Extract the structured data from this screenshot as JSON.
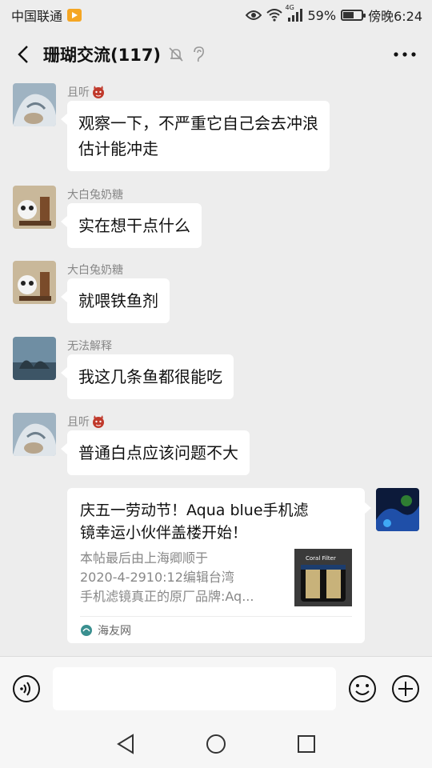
{
  "status_bar": {
    "carrier": "中国联通",
    "network": "4G",
    "battery": "59%",
    "battery_level": 0.59,
    "time": "傍晚6:24"
  },
  "nav": {
    "title": "珊瑚交流(117)"
  },
  "messages": [
    {
      "sender": "且听",
      "text_lines": [
        "观察一下，不严重它自己会去冲浪",
        "估计能冲走"
      ]
    },
    {
      "sender": "大白兔奶糖",
      "text_lines": [
        "实在想干点什么"
      ]
    },
    {
      "sender": "大白兔奶糖",
      "text_lines": [
        "就喂铁鱼剂"
      ]
    },
    {
      "sender": "无法解释",
      "text_lines": [
        "我这几条鱼都很能吃"
      ]
    },
    {
      "sender": "且听",
      "text_lines": [
        "普通白点应该问题不大"
      ]
    }
  ],
  "link_card": {
    "title_lines": [
      "庆五一劳动节！Aqua blue手机滤",
      "镜幸运小伙伴盖楼开始！"
    ],
    "desc_lines": [
      "本帖最后由上海卿顺于",
      "2020-4-2910:12编辑台湾",
      "手机滤镜真正的原厂品牌:Aq..."
    ],
    "thumb_label": "Coral Filter",
    "source": "海友网"
  },
  "input": {
    "placeholder": ""
  },
  "colors": {
    "background": "#ededed",
    "bubble": "#ffffff",
    "sender_text": "#888888"
  }
}
